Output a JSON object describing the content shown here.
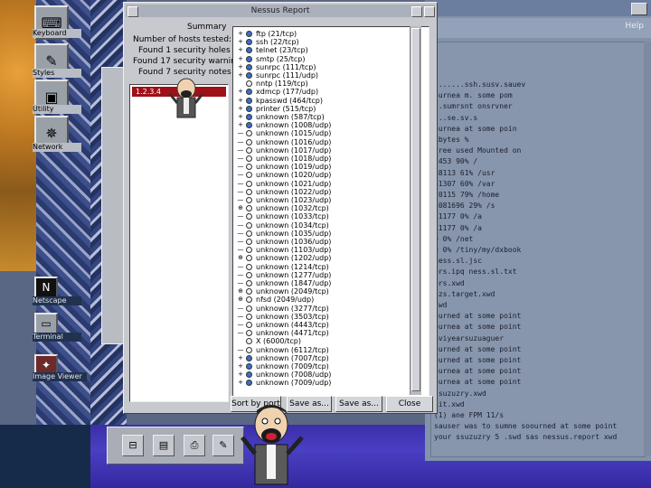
{
  "desktop": {
    "icons": [
      {
        "label": "Keyboard",
        "icon": "keyboard-icon"
      },
      {
        "label": "Styles",
        "icon": "styles-icon"
      },
      {
        "label": "Utility",
        "icon": "utility-icon"
      },
      {
        "label": "Network",
        "icon": "network-icon"
      },
      {
        "label": "Netscape",
        "icon": "netscape-icon"
      },
      {
        "label": "Terminal",
        "icon": "terminal-icon"
      },
      {
        "label": "Image Viewer",
        "icon": "image-viewer-icon"
      }
    ]
  },
  "dialog": {
    "title": "Nessus Report",
    "summary_label": "Summary",
    "summary": [
      "Number of hosts tested: 1",
      "Found 1 security holes",
      "Found 17 security warnings",
      "Found 7 security notes"
    ],
    "host": "1.2.3.4",
    "ports": [
      {
        "exp": "+",
        "status": "blue",
        "label": "ftp (21/tcp)"
      },
      {
        "exp": "+",
        "status": "blue",
        "label": "ssh (22/tcp)"
      },
      {
        "exp": "+",
        "status": "blue",
        "label": "telnet (23/tcp)"
      },
      {
        "exp": "+",
        "status": "blue",
        "label": "smtp (25/tcp)"
      },
      {
        "exp": "+",
        "status": "blue",
        "label": "sunrpc (111/tcp)"
      },
      {
        "exp": "+",
        "status": "blue",
        "label": "sunrpc (111/udp)"
      },
      {
        "exp": "",
        "status": "white",
        "label": "nntp (119/tcp)"
      },
      {
        "exp": "+",
        "status": "blue",
        "label": "xdmcp (177/udp)"
      },
      {
        "exp": "+",
        "status": "blue",
        "label": "kpasswd (464/tcp)"
      },
      {
        "exp": "+",
        "status": "blue",
        "label": "printer (515/tcp)"
      },
      {
        "exp": "+",
        "status": "blue",
        "label": "unknown (587/tcp)"
      },
      {
        "exp": "+",
        "status": "blue",
        "label": "unknown (1008/udp)"
      },
      {
        "exp": "—",
        "status": "white",
        "label": "unknown (1015/udp)"
      },
      {
        "exp": "—",
        "status": "white",
        "label": "unknown (1016/udp)"
      },
      {
        "exp": "—",
        "status": "white",
        "label": "unknown (1017/udp)"
      },
      {
        "exp": "—",
        "status": "white",
        "label": "unknown (1018/udp)"
      },
      {
        "exp": "—",
        "status": "white",
        "label": "unknown (1019/udp)"
      },
      {
        "exp": "—",
        "status": "white",
        "label": "unknown (1020/udp)"
      },
      {
        "exp": "—",
        "status": "white",
        "label": "unknown (1021/udp)"
      },
      {
        "exp": "—",
        "status": "white",
        "label": "unknown (1022/udp)"
      },
      {
        "exp": "—",
        "status": "white",
        "label": "unknown (1023/udp)"
      },
      {
        "exp": "⊕",
        "status": "white",
        "label": "unknown (1032/tcp)"
      },
      {
        "exp": "—",
        "status": "white",
        "label": "unknown (1033/tcp)"
      },
      {
        "exp": "—",
        "status": "white",
        "label": "unknown (1034/tcp)"
      },
      {
        "exp": "—",
        "status": "white",
        "label": "unknown (1035/udp)"
      },
      {
        "exp": "—",
        "status": "white",
        "label": "unknown (1036/udp)"
      },
      {
        "exp": "—",
        "status": "white",
        "label": "unknown (1103/udp)"
      },
      {
        "exp": "⊕",
        "status": "white",
        "label": "unknown (1202/udp)"
      },
      {
        "exp": "—",
        "status": "white",
        "label": "unknown (1214/tcp)"
      },
      {
        "exp": "—",
        "status": "white",
        "label": "unknown (1277/udp)"
      },
      {
        "exp": "—",
        "status": "white",
        "label": "unknown (1847/udp)"
      },
      {
        "exp": "⊕",
        "status": "white",
        "label": "unknown (2049/tcp)"
      },
      {
        "exp": "⊕",
        "status": "white",
        "label": "nfsd (2049/udp)"
      },
      {
        "exp": "—",
        "status": "white",
        "label": "unknown (3277/tcp)"
      },
      {
        "exp": "—",
        "status": "white",
        "label": "unknown (3503/tcp)"
      },
      {
        "exp": "—",
        "status": "white",
        "label": "unknown (4443/tcp)"
      },
      {
        "exp": "—",
        "status": "white",
        "label": "unknown (4471/tcp)"
      },
      {
        "exp": "",
        "status": "white",
        "label": "X (6000/tcp)"
      },
      {
        "exp": "—",
        "status": "white",
        "label": "unknown (6112/tcp)"
      },
      {
        "exp": "+",
        "status": "blue",
        "label": "unknown (7007/tcp)"
      },
      {
        "exp": "+",
        "status": "blue",
        "label": "unknown (7009/tcp)"
      },
      {
        "exp": "+",
        "status": "blue",
        "label": "unknown (7008/udp)"
      },
      {
        "exp": "+",
        "status": "blue",
        "label": "unknown (7009/udp)"
      }
    ],
    "buttons": {
      "sort": "Sort by port",
      "save": "Save as...",
      "save_as": "Save as...",
      "close": "Close"
    }
  },
  "editor": {
    "help": "Help",
    "lines": [
      ".......ssh.susv.sauev",
      "ournea m. some pom",
      "..sumrsnt onsrvner",
      "...se.sv.s",
      "ournea at some poin",
      "kbytes %",
      "free used Mounted on",
      "1453 90% /",
      "88113 61% /usr",
      "61307 60% /var",
      "70115 79% /home",
      "1081696 29% /s",
      "11177 0% /a",
      "11177 0% /a",
      "0 0% /net",
      "0 0% /tiny/my/dxbook",
      "ness.sl.jsc",
      "ers.ipq ness.sl.txt",
      "ers.xwd",
      "nzs.target.xwd",
      "xwd",
      "ourned at some point",
      "ournea at some point",
      "aviyearsuzuaguer",
      "ourned at some point",
      "ourned at some point",
      "ournea at some point",
      "ournea at some point",
      "ssuzuzry.xwd",
      "iit.xwd",
      "(1) ane FPM 11/s",
      "sauser was to sumne soourned at some point",
      "your ssuzuzry 5 .swd sas nessus.report xwd"
    ]
  },
  "colors": {
    "accent_host": "#a01018",
    "dialog_bg": "#c7c9cf",
    "editor_bg": "#8796ad"
  }
}
